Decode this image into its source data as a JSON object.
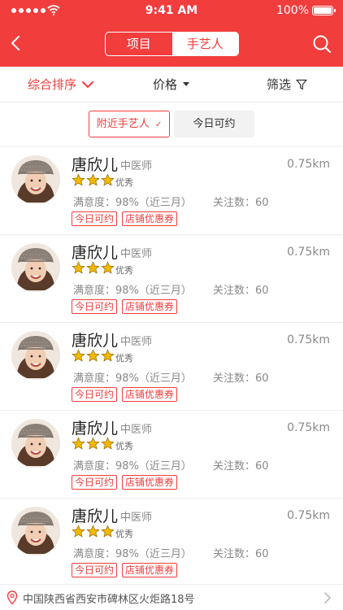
{
  "status_bar": {
    "time": "9:41 AM",
    "battery": "100%"
  },
  "nav": {
    "segments": [
      {
        "label": "项目",
        "active": false
      },
      {
        "label": "手艺人",
        "active": true
      }
    ]
  },
  "sort_bar": {
    "items": [
      {
        "label": "综合排序",
        "active": true
      },
      {
        "label": "价格"
      },
      {
        "label": "筛选"
      }
    ]
  },
  "filters": {
    "nearby": "附近手艺人",
    "today": "今日可约"
  },
  "artisans": [
    {
      "name": "唐欣儿",
      "role": "中医师",
      "distance": "0.75km",
      "rating": 3,
      "rating_label": "优秀",
      "satisfaction": "满意度：98%（近三月）",
      "followers": "关注数：60",
      "tags": [
        "今日可约",
        "店铺优惠券"
      ]
    },
    {
      "name": "唐欣儿",
      "role": "中医师",
      "distance": "0.75km",
      "rating": 3,
      "rating_label": "优秀",
      "satisfaction": "满意度：98%（近三月）",
      "followers": "关注数：60",
      "tags": [
        "今日可约",
        "店铺优惠券"
      ]
    },
    {
      "name": "唐欣儿",
      "role": "中医师",
      "distance": "0.75km",
      "rating": 3,
      "rating_label": "优秀",
      "satisfaction": "满意度：98%（近三月）",
      "followers": "关注数：60",
      "tags": [
        "今日可约",
        "店铺优惠券"
      ]
    },
    {
      "name": "唐欣儿",
      "role": "中医师",
      "distance": "0.75km",
      "rating": 3,
      "rating_label": "优秀",
      "satisfaction": "满意度：98%（近三月）",
      "followers": "关注数：60",
      "tags": [
        "今日可约",
        "店铺优惠券"
      ]
    },
    {
      "name": "唐欣儿",
      "role": "中医师",
      "distance": "0.75km",
      "rating": 3,
      "rating_label": "优秀",
      "satisfaction": "满意度：98%（近三月）",
      "followers": "关注数：60",
      "tags": [
        "今日可约",
        "店铺优惠券"
      ]
    }
  ],
  "location": {
    "address": "中国陕西省西安市碑林区火炬路18号"
  },
  "colors": {
    "accent": "#f23d3d",
    "star": "#f5b800"
  }
}
